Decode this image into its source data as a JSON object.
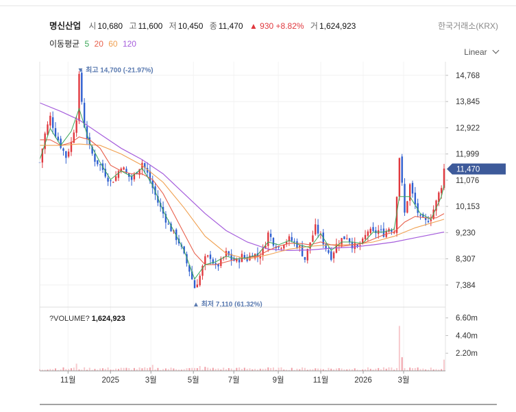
{
  "header": {
    "name": "명신산업",
    "open_label": "시",
    "open": "10,680",
    "high_label": "고",
    "high": "11,600",
    "low_label": "저",
    "low": "10,450",
    "close_label": "종",
    "close": "11,470",
    "change": "▲ 930",
    "change_pct": "+8.82%",
    "volume_label": "거",
    "volume": "1,624,923",
    "exchange": "한국거래소(KRX)"
  },
  "moving_average": {
    "label": "이동평균",
    "periods": [
      {
        "value": "5",
        "color": "#3aa757"
      },
      {
        "value": "20",
        "color": "#e8604c"
      },
      {
        "value": "60",
        "color": "#f0a050"
      },
      {
        "value": "120",
        "color": "#a55ddc"
      }
    ]
  },
  "scale_selector": "Linear",
  "chart_data": {
    "type": "candlestick",
    "y_ticks": [
      "14,768",
      "13,845",
      "12,922",
      "11,999",
      "11,076",
      "10,153",
      "9,230",
      "8,307",
      "7,384"
    ],
    "ylim": [
      6800,
      15200
    ],
    "x_ticks": [
      "11월",
      "2025",
      "3월",
      "5월",
      "7월",
      "9월",
      "11월",
      "2026",
      "3월"
    ],
    "last_price": "11,470",
    "max_annotation": "▼ 최고 14,700 (-21.97%)",
    "min_annotation": "▲ 최저 7,110 (61.32%)",
    "volume_label": "?VOLUME?",
    "volume_value": "1,624,923",
    "volume_ticks": [
      "6.60m",
      "4.40m",
      "2.20m"
    ],
    "price_path": [
      [
        0,
        11700
      ],
      [
        2,
        12700
      ],
      [
        4,
        13300
      ],
      [
        6,
        12700
      ],
      [
        8,
        12300
      ],
      [
        10,
        11900
      ],
      [
        12,
        12400
      ],
      [
        14,
        13300
      ],
      [
        15,
        14700
      ],
      [
        17,
        13000
      ],
      [
        19,
        12200
      ],
      [
        21,
        11800
      ],
      [
        23,
        11600
      ],
      [
        25,
        11300
      ],
      [
        27,
        11000
      ],
      [
        29,
        11200
      ],
      [
        31,
        11600
      ],
      [
        33,
        11300
      ],
      [
        35,
        11100
      ],
      [
        37,
        11400
      ],
      [
        39,
        11700
      ],
      [
        41,
        11300
      ],
      [
        43,
        10800
      ],
      [
        45,
        10300
      ],
      [
        47,
        9900
      ],
      [
        49,
        9500
      ],
      [
        51,
        9200
      ],
      [
        53,
        8900
      ],
      [
        55,
        8400
      ],
      [
        57,
        7900
      ],
      [
        59,
        7300
      ],
      [
        61,
        7700
      ],
      [
        63,
        8300
      ],
      [
        65,
        8400
      ],
      [
        67,
        8000
      ],
      [
        69,
        8200
      ],
      [
        71,
        8500
      ],
      [
        73,
        8300
      ],
      [
        75,
        8200
      ],
      [
        77,
        8400
      ],
      [
        79,
        8300
      ],
      [
        81,
        8500
      ],
      [
        83,
        8400
      ],
      [
        85,
        8600
      ],
      [
        87,
        9200
      ],
      [
        89,
        8900
      ],
      [
        91,
        8700
      ],
      [
        93,
        8900
      ],
      [
        95,
        9000
      ],
      [
        97,
        8900
      ],
      [
        99,
        8700
      ],
      [
        101,
        8300
      ],
      [
        103,
        8900
      ],
      [
        105,
        9400
      ],
      [
        107,
        9100
      ],
      [
        109,
        8700
      ],
      [
        111,
        8400
      ],
      [
        113,
        8800
      ],
      [
        115,
        9000
      ],
      [
        117,
        9100
      ],
      [
        119,
        8800
      ],
      [
        121,
        8700
      ],
      [
        123,
        8900
      ],
      [
        125,
        9300
      ],
      [
        127,
        9200
      ],
      [
        129,
        9300
      ],
      [
        131,
        9200
      ],
      [
        133,
        9400
      ],
      [
        135,
        9300
      ],
      [
        137,
        11900
      ],
      [
        139,
        9900
      ],
      [
        141,
        10900
      ],
      [
        143,
        10200
      ],
      [
        145,
        9700
      ],
      [
        147,
        9600
      ],
      [
        149,
        9800
      ],
      [
        151,
        10300
      ],
      [
        153,
        10900
      ],
      [
        154,
        11470
      ]
    ],
    "ma5_path": [
      [
        0,
        11800
      ],
      [
        4,
        12900
      ],
      [
        8,
        12300
      ],
      [
        12,
        12800
      ],
      [
        15,
        13600
      ],
      [
        19,
        12400
      ],
      [
        23,
        11700
      ],
      [
        27,
        11100
      ],
      [
        31,
        11400
      ],
      [
        35,
        11200
      ],
      [
        39,
        11500
      ],
      [
        43,
        10900
      ],
      [
        47,
        10000
      ],
      [
        51,
        9300
      ],
      [
        55,
        8600
      ],
      [
        59,
        7600
      ],
      [
        63,
        8100
      ],
      [
        67,
        8200
      ],
      [
        71,
        8400
      ],
      [
        75,
        8300
      ],
      [
        79,
        8350
      ],
      [
        83,
        8450
      ],
      [
        87,
        8900
      ],
      [
        91,
        8800
      ],
      [
        95,
        8950
      ],
      [
        99,
        8800
      ],
      [
        103,
        8700
      ],
      [
        107,
        9200
      ],
      [
        111,
        8600
      ],
      [
        115,
        8900
      ],
      [
        119,
        8900
      ],
      [
        123,
        8850
      ],
      [
        127,
        9250
      ],
      [
        131,
        9250
      ],
      [
        135,
        9350
      ],
      [
        137,
        10500
      ],
      [
        141,
        10500
      ],
      [
        145,
        9900
      ],
      [
        149,
        9700
      ],
      [
        153,
        10500
      ],
      [
        154,
        10900
      ]
    ],
    "ma20_path": [
      [
        0,
        12500
      ],
      [
        4,
        12500
      ],
      [
        8,
        12300
      ],
      [
        12,
        12400
      ],
      [
        15,
        12600
      ],
      [
        19,
        12500
      ],
      [
        23,
        12200
      ],
      [
        27,
        11600
      ],
      [
        31,
        11400
      ],
      [
        35,
        11300
      ],
      [
        39,
        11300
      ],
      [
        43,
        11100
      ],
      [
        47,
        10600
      ],
      [
        51,
        9900
      ],
      [
        55,
        9200
      ],
      [
        59,
        8500
      ],
      [
        63,
        8100
      ],
      [
        67,
        8100
      ],
      [
        71,
        8200
      ],
      [
        75,
        8300
      ],
      [
        79,
        8350
      ],
      [
        83,
        8400
      ],
      [
        87,
        8600
      ],
      [
        91,
        8750
      ],
      [
        95,
        8850
      ],
      [
        99,
        8850
      ],
      [
        103,
        8800
      ],
      [
        107,
        8900
      ],
      [
        111,
        8800
      ],
      [
        115,
        8750
      ],
      [
        119,
        8800
      ],
      [
        123,
        8850
      ],
      [
        127,
        9000
      ],
      [
        131,
        9150
      ],
      [
        135,
        9250
      ],
      [
        139,
        9600
      ],
      [
        143,
        9800
      ],
      [
        147,
        9750
      ],
      [
        151,
        9750
      ],
      [
        154,
        9900
      ]
    ],
    "ma60_path": [
      [
        0,
        12300
      ],
      [
        8,
        12300
      ],
      [
        15,
        12350
      ],
      [
        23,
        12300
      ],
      [
        31,
        12000
      ],
      [
        39,
        11600
      ],
      [
        47,
        11000
      ],
      [
        55,
        10100
      ],
      [
        63,
        9100
      ],
      [
        71,
        8500
      ],
      [
        79,
        8300
      ],
      [
        87,
        8450
      ],
      [
        95,
        8650
      ],
      [
        103,
        8750
      ],
      [
        111,
        8800
      ],
      [
        119,
        8800
      ],
      [
        127,
        8900
      ],
      [
        135,
        9100
      ],
      [
        143,
        9400
      ],
      [
        154,
        9700
      ]
    ],
    "ma120_path": [
      [
        0,
        13800
      ],
      [
        8,
        13500
      ],
      [
        15,
        13200
      ],
      [
        23,
        12700
      ],
      [
        31,
        12200
      ],
      [
        39,
        11800
      ],
      [
        47,
        11300
      ],
      [
        55,
        10600
      ],
      [
        63,
        9900
      ],
      [
        71,
        9300
      ],
      [
        79,
        8900
      ],
      [
        87,
        8650
      ],
      [
        95,
        8600
      ],
      [
        103,
        8620
      ],
      [
        111,
        8680
      ],
      [
        119,
        8720
      ],
      [
        127,
        8800
      ],
      [
        135,
        8900
      ],
      [
        143,
        9050
      ],
      [
        154,
        9250
      ]
    ],
    "volume_spikes": [
      [
        14,
        0.9
      ],
      [
        43,
        0.75
      ],
      [
        61,
        0.6
      ],
      [
        63,
        0.5
      ],
      [
        137,
        5.6
      ],
      [
        138,
        1.7
      ],
      [
        154,
        1.4
      ]
    ]
  }
}
